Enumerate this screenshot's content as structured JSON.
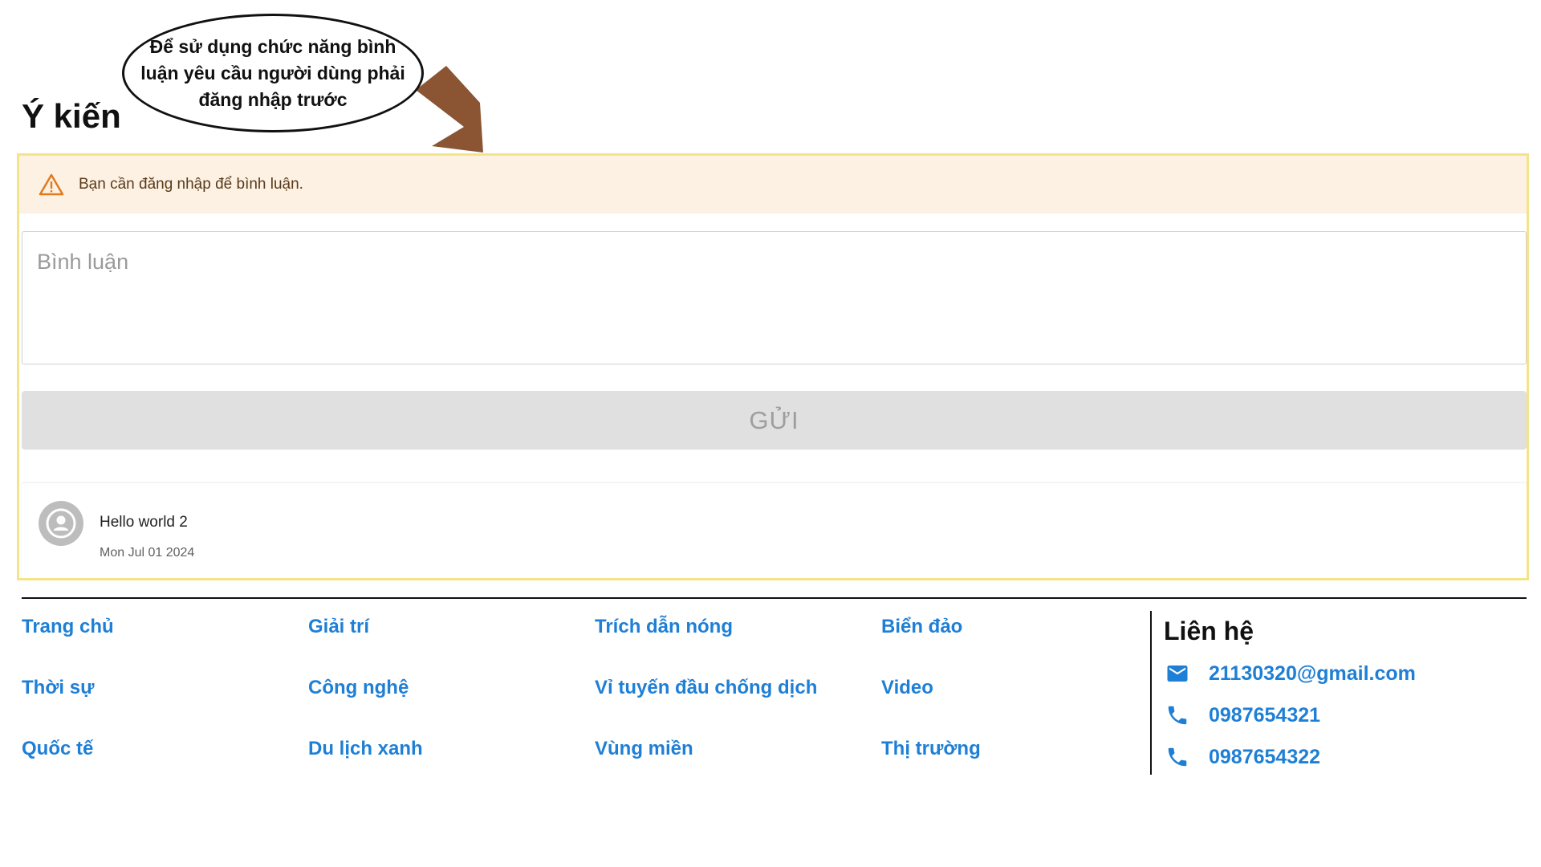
{
  "callout": {
    "text": "Để sử dụng chức năng bình luận yêu cầu người dùng phải đăng nhập trước"
  },
  "section": {
    "title": "Ý kiến"
  },
  "alert": {
    "icon": "warning-icon",
    "text": "Bạn cần đăng nhập để bình luận."
  },
  "comment_form": {
    "placeholder": "Bình luận",
    "value": "",
    "submit_label": "GỬI"
  },
  "comments": [
    {
      "text": "Hello world 2",
      "date": "Mon Jul 01 2024",
      "avatar_icon": "account-circle-icon"
    }
  ],
  "footer": {
    "links": [
      [
        "Trang chủ",
        "Thời sự",
        "Quốc tế"
      ],
      [
        "Giải trí",
        "Công nghệ",
        "Du lịch xanh"
      ],
      [
        "Trích dẫn nóng",
        "Vỉ tuyến đầu chống dịch",
        "Vùng miền"
      ],
      [
        "Biển đảo",
        "Video",
        "Thị trường"
      ]
    ],
    "contact": {
      "title": "Liên hệ",
      "email": "21130320@gmail.com",
      "phones": [
        "0987654321",
        "0987654322"
      ]
    }
  },
  "colors": {
    "link": "#1e7fd6",
    "alert_bg": "#fdf1e4",
    "alert_icon": "#e07a1f",
    "highlight_frame": "#f3e488",
    "arrow": "#8b5533",
    "button_bg": "#e0e0e0"
  }
}
